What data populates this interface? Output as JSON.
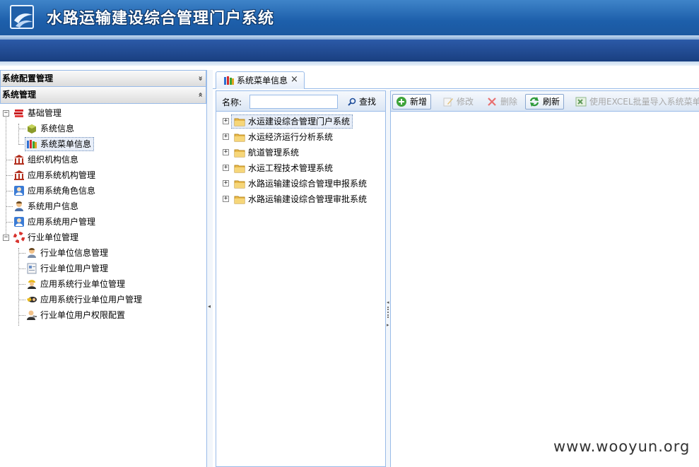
{
  "app": {
    "title": "水路运输建设综合管理门户系统"
  },
  "left_panel": {
    "sections": [
      {
        "label": "系统配置管理",
        "toggle": "»"
      },
      {
        "label": "系统管理",
        "toggle": "«"
      }
    ],
    "tree": {
      "basic": {
        "label": "基础管理",
        "expander": "−"
      },
      "system_info": {
        "label": "系统信息"
      },
      "system_menu_info": {
        "label": "系统菜单信息"
      },
      "org_info": {
        "label": "组织机构信息"
      },
      "app_org_mgmt": {
        "label": "应用系统机构管理"
      },
      "app_role_info": {
        "label": "应用系统角色信息"
      },
      "sys_user_info": {
        "label": "系统用户信息"
      },
      "app_user_mgmt": {
        "label": "应用系统用户管理"
      },
      "industry": {
        "label": "行业单位管理",
        "expander": "−"
      },
      "industry_unit_info": {
        "label": "行业单位信息管理"
      },
      "industry_user_mgmt": {
        "label": "行业单位用户管理"
      },
      "app_industry_unit": {
        "label": "应用系统行业单位管理"
      },
      "app_industry_user": {
        "label": "应用系统行业单位用户管理"
      },
      "industry_permission": {
        "label": "行业单位用户权限配置"
      }
    }
  },
  "tabs": [
    {
      "label": "系统菜单信息",
      "close": "×"
    }
  ],
  "middle": {
    "name_label": "名称:",
    "name_value": "",
    "search_label": "查找",
    "tree": {
      "expander": "+",
      "items": [
        {
          "label": "水运建设综合管理门户系统"
        },
        {
          "label": "水运经济运行分析系统"
        },
        {
          "label": "航道管理系统"
        },
        {
          "label": "水运工程技术管理系统"
        },
        {
          "label": "水路运输建设综合管理申报系统"
        },
        {
          "label": "水路运输建设综合管理审批系统"
        }
      ]
    }
  },
  "right": {
    "toolbar": {
      "add": "新增",
      "edit": "修改",
      "delete": "删除",
      "refresh": "刷新",
      "import": "使用EXCEL批量导入系统菜单"
    }
  },
  "watermark": "www.wooyun.org",
  "colors": {
    "header": "#1d5fab",
    "border": "#99bbe8",
    "navbar": "#193f80"
  }
}
